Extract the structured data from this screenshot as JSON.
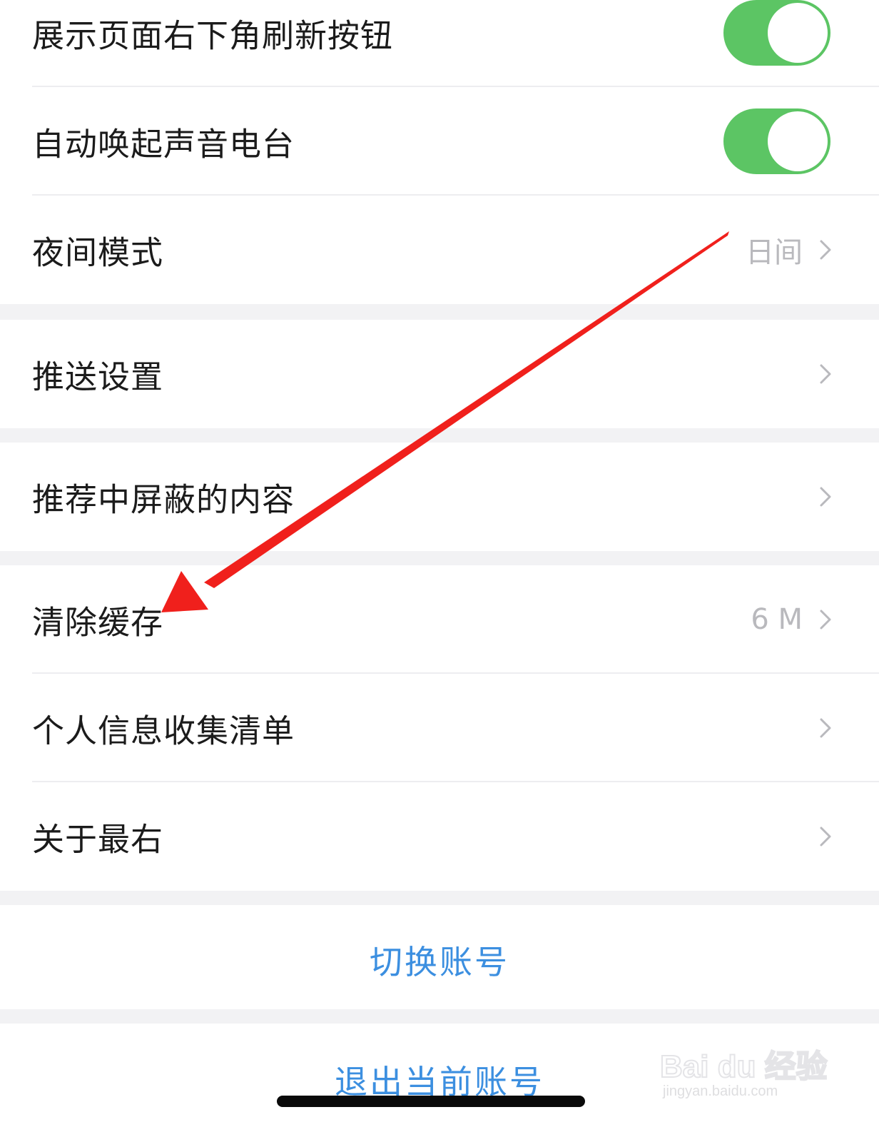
{
  "settings": {
    "refresh_button": {
      "label": "展示页面右下角刷新按钮",
      "enabled": true
    },
    "auto_radio": {
      "label": "自动唤起声音电台",
      "enabled": true
    },
    "night_mode": {
      "label": "夜间模式",
      "value": "日间"
    },
    "push": {
      "label": "推送设置"
    },
    "blocked": {
      "label": "推荐中屏蔽的内容"
    },
    "cache": {
      "label": "清除缓存",
      "value": "6 M"
    },
    "personal_info": {
      "label": "个人信息收集清单"
    },
    "about": {
      "label": "关于最右"
    }
  },
  "actions": {
    "switch_account": "切换账号",
    "logout": "退出当前账号"
  },
  "colors": {
    "toggle_on": "#5cc564",
    "action_text": "#3c8fe0",
    "annotation_arrow": "#f0201c"
  },
  "watermark": {
    "brand": "Bai du 经验",
    "url": "jingyan.baidu.com"
  }
}
